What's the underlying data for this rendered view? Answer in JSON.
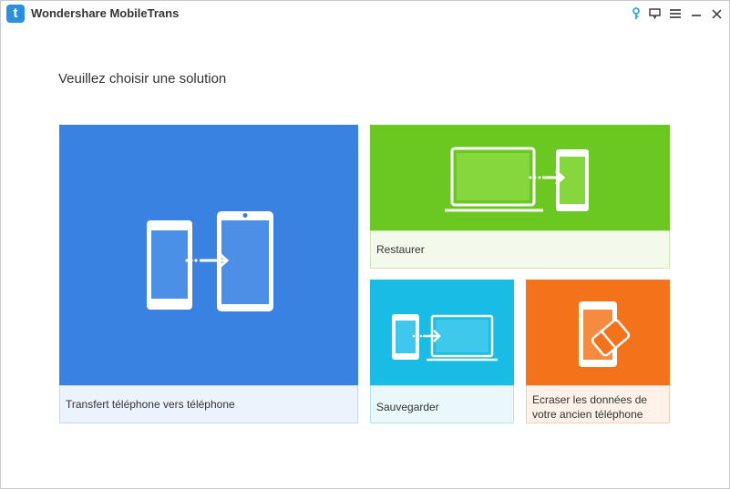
{
  "window": {
    "title": "Wondershare MobileTrans",
    "logo_letter": "t",
    "controls": [
      "key-icon",
      "feedback-icon",
      "menu-icon",
      "minimize-icon",
      "close-icon"
    ]
  },
  "main": {
    "heading": "Veuillez choisir une solution",
    "tiles": [
      {
        "label": "Transfert téléphone vers téléphone",
        "color": "#3a82e2",
        "icon": "phone-to-phone-icon"
      },
      {
        "label": "Restaurer",
        "color": "#6bc821",
        "icon": "laptop-to-phone-icon"
      },
      {
        "label": "Sauvegarder",
        "color": "#19bce4",
        "icon": "phone-to-laptop-icon"
      },
      {
        "label": "Ecraser les données de votre ancien téléphone",
        "color": "#f4731a",
        "icon": "phone-eraser-icon"
      }
    ]
  }
}
